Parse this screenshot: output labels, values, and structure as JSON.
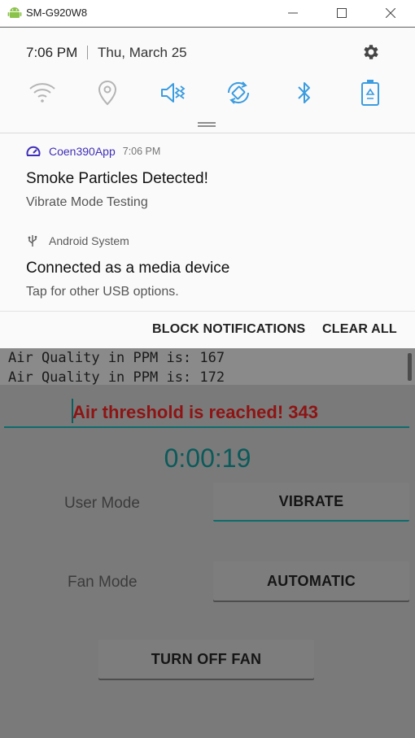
{
  "window": {
    "title": "SM-G920W8",
    "icons": {
      "app": "android-icon",
      "minimize": "minimize-icon",
      "maximize": "maximize-icon",
      "close": "close-icon"
    }
  },
  "status": {
    "time": "7:06 PM",
    "date": "Thu, March 25",
    "settings_icon": "gear-icon",
    "tiles": [
      {
        "icon": "wifi-icon",
        "active": false
      },
      {
        "icon": "location-icon",
        "active": false
      },
      {
        "icon": "vibrate-icon",
        "active": true
      },
      {
        "icon": "auto-rotate-icon",
        "active": true
      },
      {
        "icon": "bluetooth-icon",
        "active": true
      },
      {
        "icon": "power-saving-icon",
        "active": true
      }
    ],
    "accent": "#3b9ce0"
  },
  "notifications": [
    {
      "app": "Coen390App",
      "time": "7:06 PM",
      "title": "Smoke Particles Detected!",
      "text": "Vibrate Mode Testing",
      "icon": "gauge-icon",
      "app_color": "#3f2fb8"
    },
    {
      "app": "Android System",
      "title": "Connected as a media device",
      "text": "Tap for other USB options.",
      "icon": "usb-icon"
    }
  ],
  "actions": {
    "block": "BLOCK NOTIFICATIONS",
    "clear": "CLEAR ALL"
  },
  "app": {
    "console_lines": [
      "Air Quality in PPM is: 167",
      "Air Quality in PPM is: 172"
    ],
    "alert": "Air threshold is reached! 343",
    "alert_color": "#8e1414",
    "timer": "0:00:19",
    "user_mode_label": "User Mode",
    "user_mode_value": "VIBRATE",
    "fan_mode_label": "Fan Mode",
    "fan_mode_value": "AUTOMATIC",
    "fan_button": "TURN OFF FAN"
  }
}
